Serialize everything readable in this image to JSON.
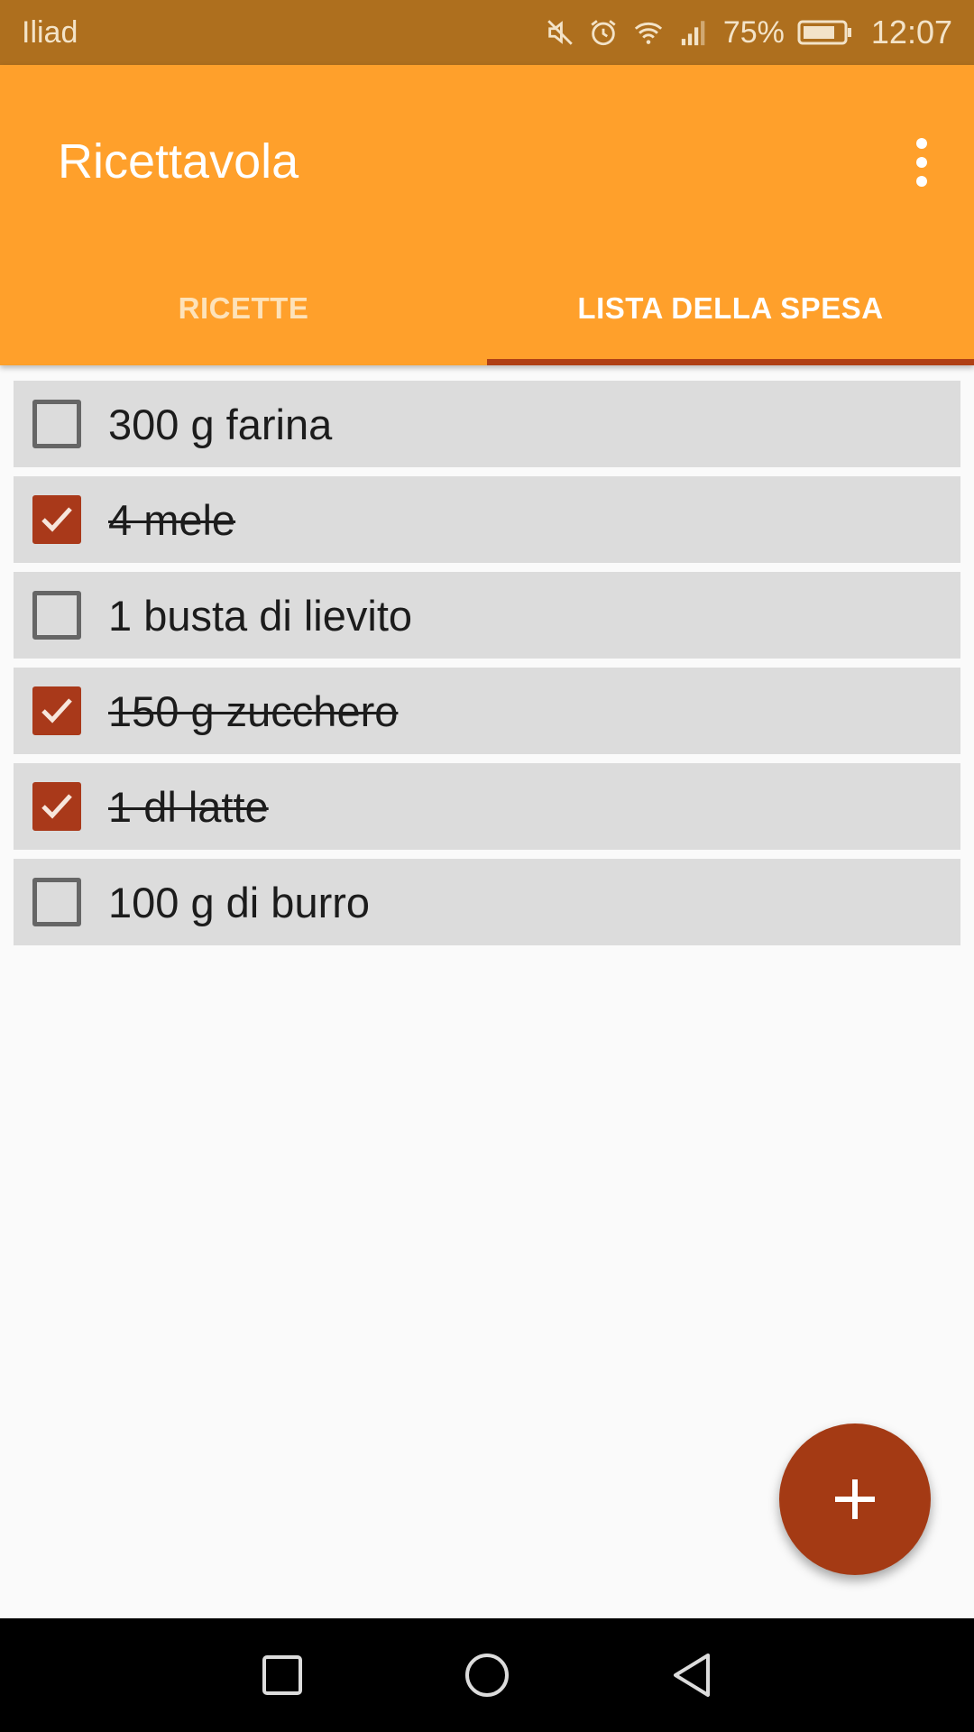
{
  "status_bar": {
    "carrier": "Iliad",
    "battery_percent": "75%",
    "time": "12:07"
  },
  "app_bar": {
    "title": "Ricettavola"
  },
  "tabs": [
    {
      "label": "RICETTE",
      "active": false
    },
    {
      "label": "LISTA DELLA SPESA",
      "active": true
    }
  ],
  "shopping_list": [
    {
      "label": "300 g farina",
      "checked": false
    },
    {
      "label": "4 mele",
      "checked": true
    },
    {
      "label": "1 busta di lievito",
      "checked": false
    },
    {
      "label": "150 g zucchero",
      "checked": true
    },
    {
      "label": "1 dl latte",
      "checked": true
    },
    {
      "label": "100 g di burro",
      "checked": false
    }
  ],
  "colors": {
    "status_bar": "#ae6f1e",
    "app_bar": "#ffa02b",
    "accent": "#a9391a",
    "tab_indicator": "#b04015",
    "list_item_bg": "#dcdcdc"
  },
  "icons": {
    "fab": "plus-icon",
    "overflow": "more-vert-icon",
    "nav": [
      "recents-square-icon",
      "home-circle-icon",
      "back-triangle-icon"
    ]
  }
}
